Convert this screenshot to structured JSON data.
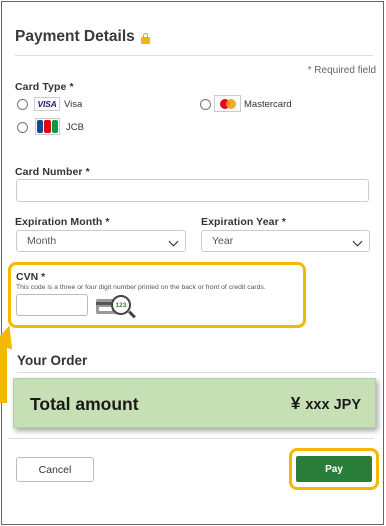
{
  "payment": {
    "title": "Payment Details",
    "required_note": "* Required field",
    "card_type_label": "Card Type *",
    "card_types": [
      {
        "brand_text": "VISA",
        "label": "Visa"
      },
      {
        "brand_text": "",
        "label": "Mastercard"
      },
      {
        "brand_text": "JCB",
        "label": "JCB"
      }
    ],
    "card_number_label": "Card Number *",
    "card_number_value": "",
    "exp_month_label": "Expiration Month *",
    "exp_month_value": "Month",
    "exp_year_label": "Expiration Year *",
    "exp_year_value": "Year",
    "cvn_label": "CVN *",
    "cvn_help": "This code is a three or four digit number printed on the back or front of credit cards.",
    "cvn_value": "",
    "cvn_icon_text": "123"
  },
  "order": {
    "title": "Your Order",
    "total_label": "Total amount",
    "currency_symbol": "¥",
    "total_value": "xxx JPY"
  },
  "actions": {
    "cancel_label": "Cancel",
    "pay_label": "Pay"
  },
  "colors": {
    "highlight": "#f5b800",
    "pay_button": "#2a7d3b",
    "total_bg": "#c6dfb5"
  },
  "icons": [
    "lock-icon",
    "visa-logo-icon",
    "mastercard-logo-icon",
    "jcb-logo-icon",
    "chevron-down-icon",
    "card-magnifier-icon",
    "arrow-icon"
  ]
}
